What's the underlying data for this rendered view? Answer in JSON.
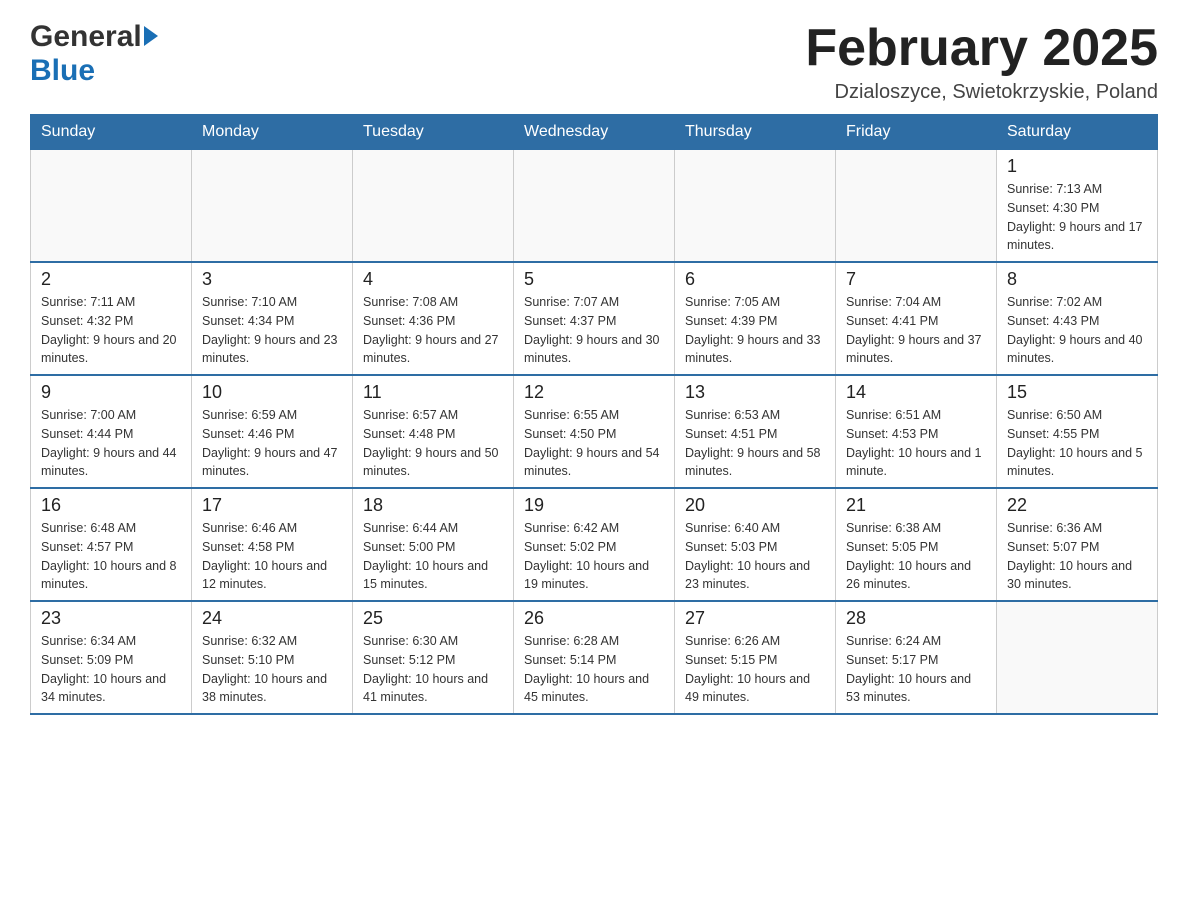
{
  "header": {
    "month_title": "February 2025",
    "location": "Dzialoszyce, Swietokrzyskie, Poland",
    "logo_general": "General",
    "logo_blue": "Blue"
  },
  "days_of_week": [
    "Sunday",
    "Monday",
    "Tuesday",
    "Wednesday",
    "Thursday",
    "Friday",
    "Saturday"
  ],
  "weeks": [
    {
      "days": [
        {
          "date": "",
          "info": ""
        },
        {
          "date": "",
          "info": ""
        },
        {
          "date": "",
          "info": ""
        },
        {
          "date": "",
          "info": ""
        },
        {
          "date": "",
          "info": ""
        },
        {
          "date": "",
          "info": ""
        },
        {
          "date": "1",
          "info": "Sunrise: 7:13 AM\nSunset: 4:30 PM\nDaylight: 9 hours and 17 minutes."
        }
      ]
    },
    {
      "days": [
        {
          "date": "2",
          "info": "Sunrise: 7:11 AM\nSunset: 4:32 PM\nDaylight: 9 hours and 20 minutes."
        },
        {
          "date": "3",
          "info": "Sunrise: 7:10 AM\nSunset: 4:34 PM\nDaylight: 9 hours and 23 minutes."
        },
        {
          "date": "4",
          "info": "Sunrise: 7:08 AM\nSunset: 4:36 PM\nDaylight: 9 hours and 27 minutes."
        },
        {
          "date": "5",
          "info": "Sunrise: 7:07 AM\nSunset: 4:37 PM\nDaylight: 9 hours and 30 minutes."
        },
        {
          "date": "6",
          "info": "Sunrise: 7:05 AM\nSunset: 4:39 PM\nDaylight: 9 hours and 33 minutes."
        },
        {
          "date": "7",
          "info": "Sunrise: 7:04 AM\nSunset: 4:41 PM\nDaylight: 9 hours and 37 minutes."
        },
        {
          "date": "8",
          "info": "Sunrise: 7:02 AM\nSunset: 4:43 PM\nDaylight: 9 hours and 40 minutes."
        }
      ]
    },
    {
      "days": [
        {
          "date": "9",
          "info": "Sunrise: 7:00 AM\nSunset: 4:44 PM\nDaylight: 9 hours and 44 minutes."
        },
        {
          "date": "10",
          "info": "Sunrise: 6:59 AM\nSunset: 4:46 PM\nDaylight: 9 hours and 47 minutes."
        },
        {
          "date": "11",
          "info": "Sunrise: 6:57 AM\nSunset: 4:48 PM\nDaylight: 9 hours and 50 minutes."
        },
        {
          "date": "12",
          "info": "Sunrise: 6:55 AM\nSunset: 4:50 PM\nDaylight: 9 hours and 54 minutes."
        },
        {
          "date": "13",
          "info": "Sunrise: 6:53 AM\nSunset: 4:51 PM\nDaylight: 9 hours and 58 minutes."
        },
        {
          "date": "14",
          "info": "Sunrise: 6:51 AM\nSunset: 4:53 PM\nDaylight: 10 hours and 1 minute."
        },
        {
          "date": "15",
          "info": "Sunrise: 6:50 AM\nSunset: 4:55 PM\nDaylight: 10 hours and 5 minutes."
        }
      ]
    },
    {
      "days": [
        {
          "date": "16",
          "info": "Sunrise: 6:48 AM\nSunset: 4:57 PM\nDaylight: 10 hours and 8 minutes."
        },
        {
          "date": "17",
          "info": "Sunrise: 6:46 AM\nSunset: 4:58 PM\nDaylight: 10 hours and 12 minutes."
        },
        {
          "date": "18",
          "info": "Sunrise: 6:44 AM\nSunset: 5:00 PM\nDaylight: 10 hours and 15 minutes."
        },
        {
          "date": "19",
          "info": "Sunrise: 6:42 AM\nSunset: 5:02 PM\nDaylight: 10 hours and 19 minutes."
        },
        {
          "date": "20",
          "info": "Sunrise: 6:40 AM\nSunset: 5:03 PM\nDaylight: 10 hours and 23 minutes."
        },
        {
          "date": "21",
          "info": "Sunrise: 6:38 AM\nSunset: 5:05 PM\nDaylight: 10 hours and 26 minutes."
        },
        {
          "date": "22",
          "info": "Sunrise: 6:36 AM\nSunset: 5:07 PM\nDaylight: 10 hours and 30 minutes."
        }
      ]
    },
    {
      "days": [
        {
          "date": "23",
          "info": "Sunrise: 6:34 AM\nSunset: 5:09 PM\nDaylight: 10 hours and 34 minutes."
        },
        {
          "date": "24",
          "info": "Sunrise: 6:32 AM\nSunset: 5:10 PM\nDaylight: 10 hours and 38 minutes."
        },
        {
          "date": "25",
          "info": "Sunrise: 6:30 AM\nSunset: 5:12 PM\nDaylight: 10 hours and 41 minutes."
        },
        {
          "date": "26",
          "info": "Sunrise: 6:28 AM\nSunset: 5:14 PM\nDaylight: 10 hours and 45 minutes."
        },
        {
          "date": "27",
          "info": "Sunrise: 6:26 AM\nSunset: 5:15 PM\nDaylight: 10 hours and 49 minutes."
        },
        {
          "date": "28",
          "info": "Sunrise: 6:24 AM\nSunset: 5:17 PM\nDaylight: 10 hours and 53 minutes."
        },
        {
          "date": "",
          "info": ""
        }
      ]
    }
  ]
}
